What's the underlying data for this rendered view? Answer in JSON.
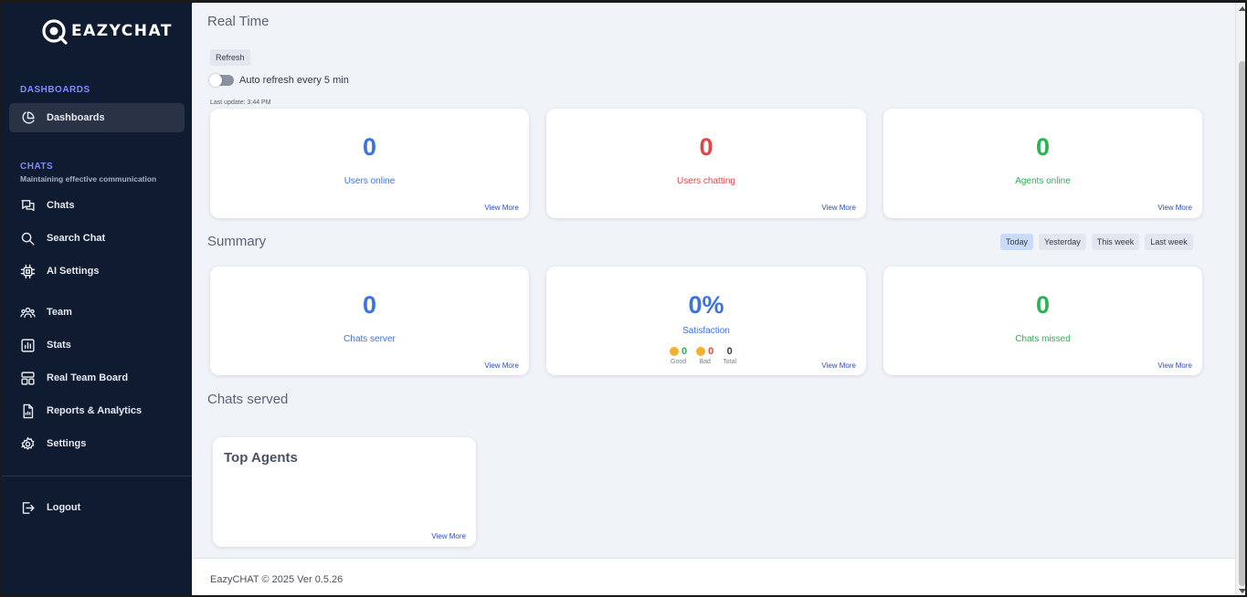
{
  "app": {
    "brand": "EAZYCHAT"
  },
  "sidebar": {
    "sections": {
      "dashboards": {
        "title": "DASHBOARDS"
      },
      "chats": {
        "title": "CHATS",
        "subtitle": "Maintaining effective communication"
      }
    },
    "items": {
      "dashboards": "Dashboards",
      "chats": "Chats",
      "search_chat": "Search Chat",
      "ai_settings": "AI Settings",
      "team": "Team",
      "stats": "Stats",
      "real_team_board": "Real Team Board",
      "reports": "Reports & Analytics",
      "settings": "Settings",
      "logout": "Logout"
    }
  },
  "realtime": {
    "title": "Real Time",
    "refresh_label": "Refresh",
    "auto_refresh_label": "Auto refresh every 5 min",
    "last_update": "Last update: 3:44 PM",
    "cards": {
      "users_online": {
        "value": "0",
        "label": "Users online",
        "more": "View More"
      },
      "users_chatting": {
        "value": "0",
        "label": "Users chatting",
        "more": "View More"
      },
      "agents_online": {
        "value": "0",
        "label": "Agents online",
        "more": "View More"
      }
    }
  },
  "summary": {
    "title": "Summary",
    "filters": {
      "today": "Today",
      "yesterday": "Yesterday",
      "this_week": "This week",
      "last_week": "Last week"
    },
    "cards": {
      "chats_server": {
        "value": "0",
        "label": "Chats server",
        "more": "View More"
      },
      "satisfaction": {
        "value": "0%",
        "label": "Satisfaction",
        "more": "View More",
        "good_value": "0",
        "good_label": "Good",
        "bad_value": "0",
        "bad_label": "Bad",
        "total_value": "0",
        "total_label": "Total"
      },
      "chats_missed": {
        "value": "0",
        "label": "Chats missed",
        "more": "View More"
      }
    }
  },
  "chats_served": {
    "title": "Chats served"
  },
  "top_agents": {
    "title": "Top Agents",
    "more": "View More"
  },
  "footer": {
    "text": "EazyCHAT © 2025 Ver 0.5.26"
  },
  "colors": {
    "sidebar_bg": "#0f1b30",
    "accent": "#7f8cff",
    "blue": "#3b73e0",
    "red": "#e04545",
    "green": "#2eb055"
  }
}
